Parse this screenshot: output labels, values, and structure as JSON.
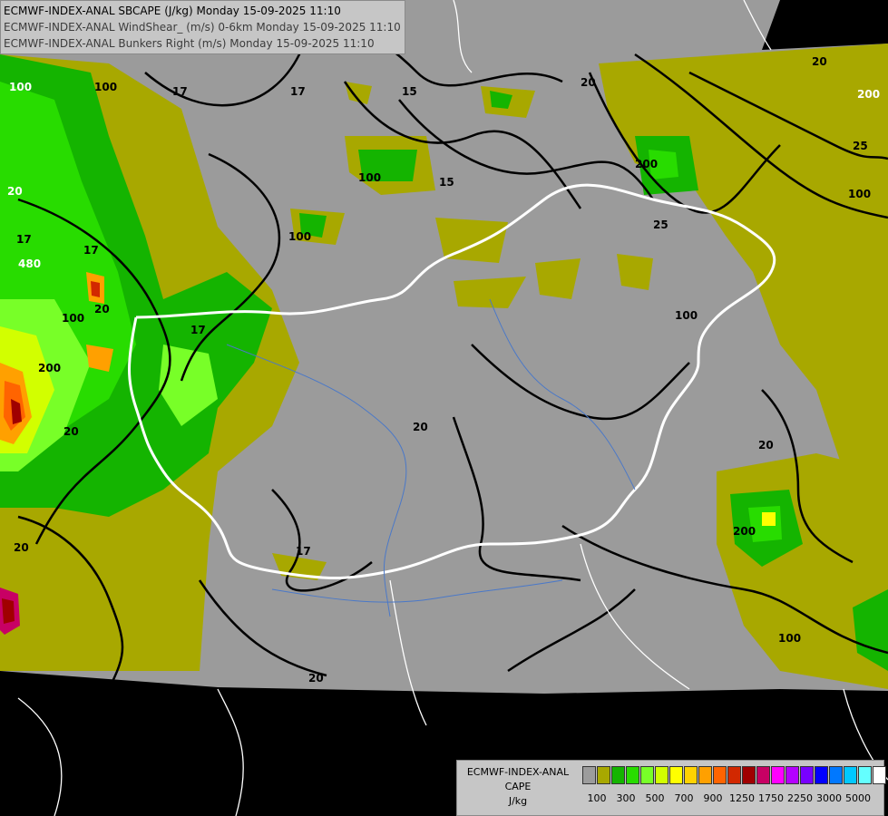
{
  "titles": [
    "ECMWF-INDEX-ANAL SBCAPE (J/kg) Monday 15-09-2025 11:10",
    "ECMWF-INDEX-ANAL WindShear_ (m/s) 0-6km Monday 15-09-2025 11:10",
    "ECMWF-INDEX-ANAL Bunkers Right (m/s) Monday 15-09-2025 11:10"
  ],
  "legend": {
    "title_lines": [
      "ECMWF-INDEX-ANAL",
      "CAPE",
      "J/kg"
    ],
    "colors": [
      "#9c9c9c",
      "#a8a800",
      "#14b400",
      "#28dc00",
      "#78ff28",
      "#d2ff00",
      "#ffff00",
      "#ffd200",
      "#ffa000",
      "#ff6400",
      "#d22800",
      "#a00000",
      "#c80064",
      "#ff00ff",
      "#b400ff",
      "#7800ff",
      "#0000ff",
      "#0078ff",
      "#00c8ff",
      "#64ffff",
      "#ffffff"
    ],
    "tick_labels": [
      "100",
      "300",
      "500",
      "700",
      "900",
      "1250",
      "1750",
      "2250",
      "3000",
      "5000"
    ]
  },
  "contour_labels": [
    "100",
    "100",
    "17",
    "17",
    "15",
    "20",
    "20",
    "200",
    "100",
    "15",
    "17",
    "17",
    "480",
    "20",
    "100",
    "20",
    "200",
    "100",
    "25",
    "17",
    "200",
    "100",
    "20",
    "20",
    "20",
    "17",
    "20",
    "100",
    "200",
    "20",
    "25",
    "100"
  ]
}
